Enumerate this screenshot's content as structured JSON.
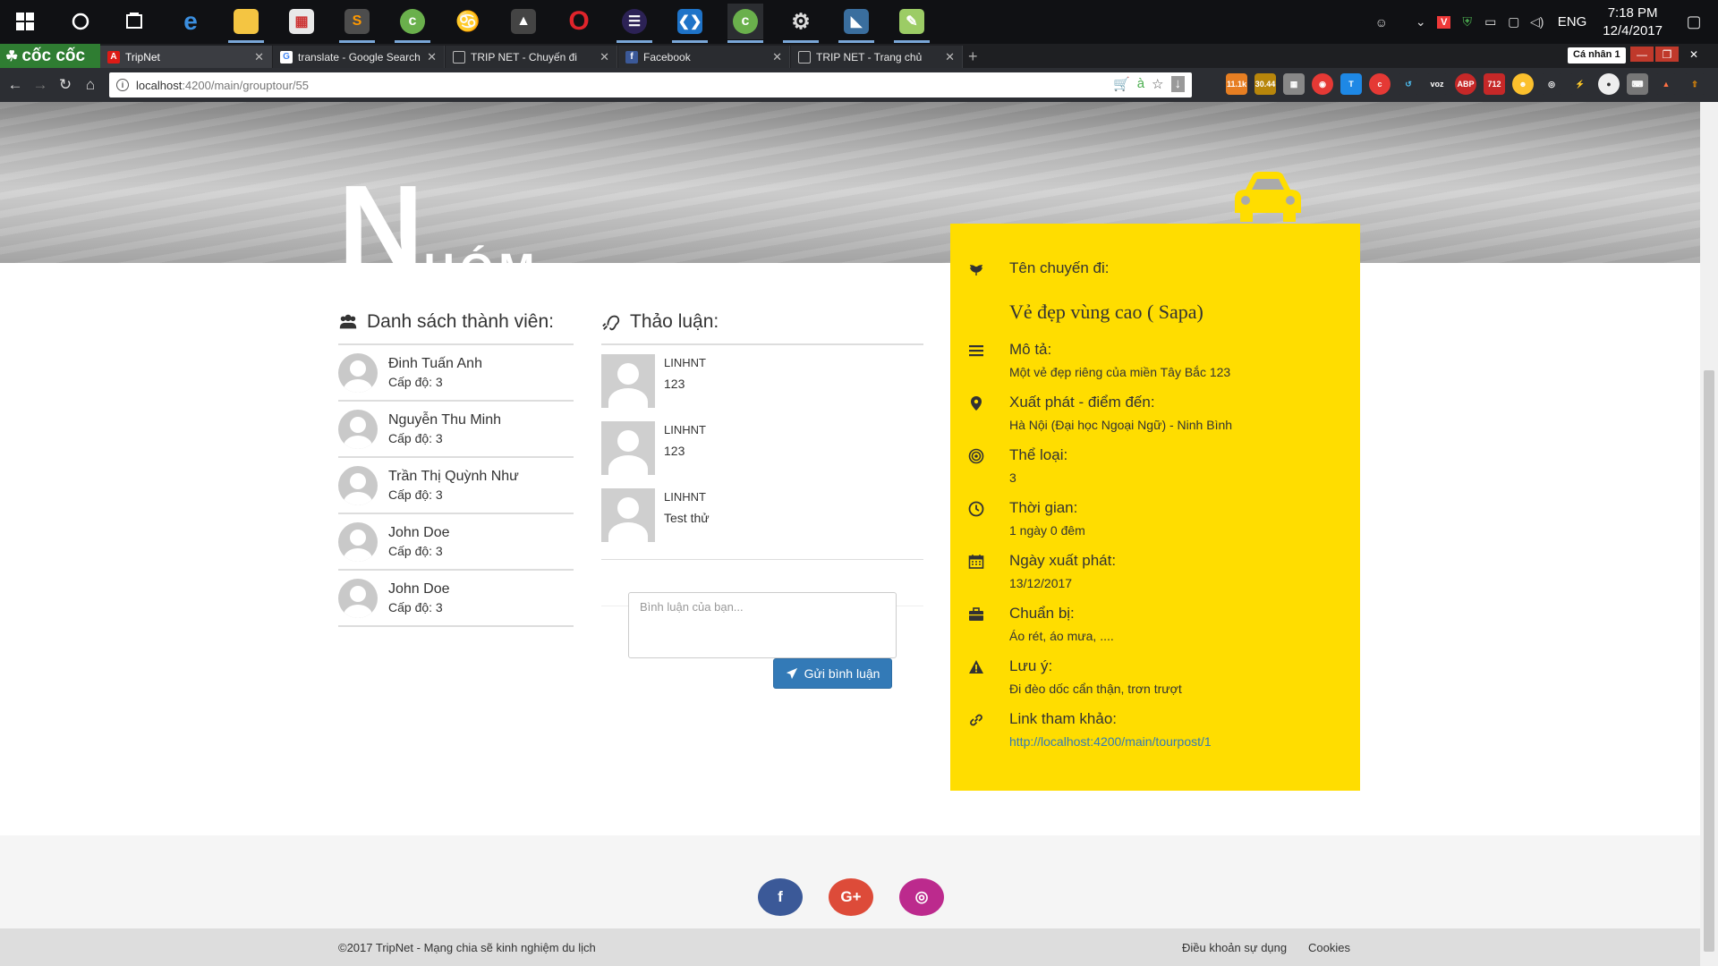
{
  "taskbar": {
    "apps": [
      {
        "name": "start-button"
      },
      {
        "name": "cortana"
      },
      {
        "name": "task-view"
      },
      {
        "name": "edge"
      },
      {
        "name": "file-explorer"
      },
      {
        "name": "app-store"
      },
      {
        "name": "sublime-text"
      },
      {
        "name": "coccoc-app"
      },
      {
        "name": "garena"
      },
      {
        "name": "app-dark"
      },
      {
        "name": "opera"
      },
      {
        "name": "eclipse"
      },
      {
        "name": "vscode"
      },
      {
        "name": "coccoc-active"
      },
      {
        "name": "settings-gear"
      },
      {
        "name": "mysql-workbench"
      },
      {
        "name": "notepad"
      }
    ],
    "clock_time": "7:18 PM",
    "clock_date": "12/4/2017",
    "language": "ENG"
  },
  "browser": {
    "brand": "cốc cốc",
    "tabs": [
      {
        "title": "TripNet",
        "favicon": "A",
        "active": true
      },
      {
        "title": "translate - Google Search",
        "favicon": "G"
      },
      {
        "title": "TRIP NET - Chuyến đi",
        "favicon": "doc"
      },
      {
        "title": "Facebook",
        "favicon": "f"
      },
      {
        "title": "TRIP NET - Trang chủ",
        "favicon": "doc"
      }
    ],
    "profile": "Cá nhân 1",
    "url_host": "localhost",
    "url_rest": ":4200/main/grouptour/55",
    "ext_badges": [
      "11.1k",
      "30.44",
      "712"
    ]
  },
  "hero": {
    "big_letter": "N",
    "rest": "HÓM"
  },
  "members": {
    "heading": "Danh sách thành viên:",
    "list": [
      {
        "name": "Đinh Tuấn Anh",
        "level": "Cấp độ: 3"
      },
      {
        "name": "Nguyễn Thu Minh",
        "level": "Cấp độ: 3"
      },
      {
        "name": "Trần Thị Quỳnh Như",
        "level": "Cấp độ: 3"
      },
      {
        "name": "John Doe",
        "level": "Cấp độ: 3"
      },
      {
        "name": "John Doe",
        "level": "Cấp độ: 3"
      }
    ]
  },
  "discussion": {
    "heading": "Thảo luận:",
    "comments": [
      {
        "author": "LINHNT",
        "text": "123"
      },
      {
        "author": "LINHNT",
        "text": "123"
      },
      {
        "author": "LINHNT",
        "text": "Test thử"
      }
    ],
    "input_placeholder": "Bình luận của bạn...",
    "send_label": "Gửi bình luận"
  },
  "trip": {
    "name_label": "Tên chuyến đi:",
    "name_value": "Vẻ đẹp vùng cao ( Sapa)",
    "desc_label": "Mô tả:",
    "desc_value": "Một vẻ đẹp riêng của miền Tây Bắc 123",
    "route_label": "Xuất phát - điểm đến:",
    "route_value": "Hà Nội (Đại học Ngoại Ngữ) - Ninh Bình",
    "category_label": "Thể loại:",
    "category_value": "3",
    "time_label": "Thời gian:",
    "time_value": "1 ngày 0 đêm",
    "start_label": "Ngày xuất phát:",
    "start_value": "13/12/2017",
    "prep_label": "Chuẩn bị:",
    "prep_value": "Áo rét, áo mưa, ....",
    "note_label": "Lưu ý:",
    "note_value": "Đi đèo dốc cẩn thận, trơn trượt",
    "link_label": "Link tham khảo:",
    "link_value": "http://localhost:4200/main/tourpost/1",
    "card_color": "#ffdd00"
  },
  "footer": {
    "social": [
      {
        "name": "facebook",
        "glyph": "f",
        "color": "#3b5998"
      },
      {
        "name": "google-plus",
        "glyph": "G+",
        "color": "#dd4b39"
      },
      {
        "name": "instagram",
        "glyph": "◎",
        "color": "#bc2a8d"
      }
    ],
    "copyright": "©2017 TripNet - Mạng chia sẽ kinh nghiệm du lịch",
    "terms": "Điều khoản sự dụng",
    "cookies": "Cookies"
  }
}
